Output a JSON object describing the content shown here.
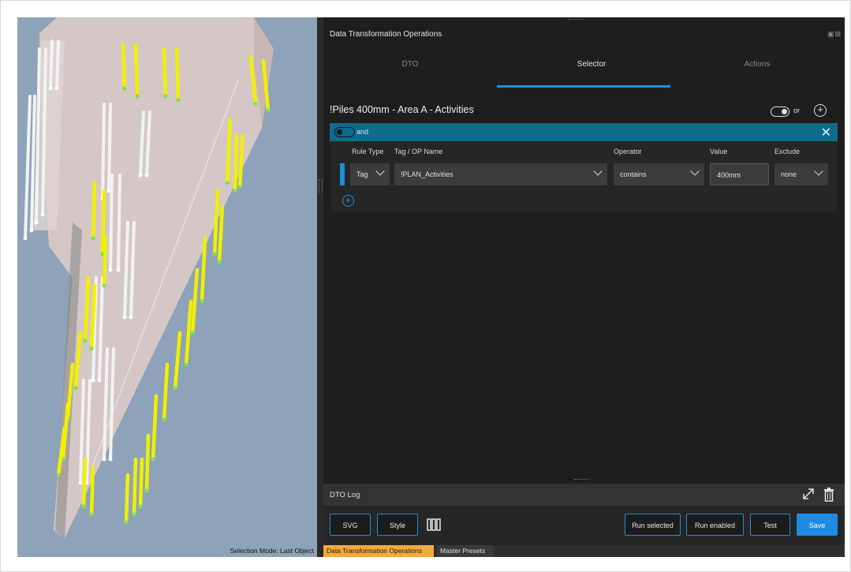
{
  "viewport": {
    "selection_mode": "Selection Mode: Last Object"
  },
  "panel": {
    "title": "Data Transformation Operations",
    "window_controls": "▣⊠",
    "tabs": [
      {
        "label": "DTO",
        "active": false
      },
      {
        "label": "Selector",
        "active": true
      },
      {
        "label": "Actions",
        "active": false
      }
    ],
    "preset_name": "!Piles 400mm - Area A - Activities",
    "group_logic": {
      "label": "or",
      "on": true
    }
  },
  "rule_group": {
    "logic_label": "and",
    "logic_on": false,
    "columns": {
      "rule_type": "Rule Type",
      "tag": "Tag / OP Name",
      "operator": "Operator",
      "value": "Value",
      "exclude": "Exclude"
    },
    "rules": [
      {
        "rule_type": "Tag",
        "tag": "!PLAN_Activities",
        "operator": "contains",
        "value": "400mm",
        "exclude": "none"
      }
    ]
  },
  "log": {
    "label": "DTO Log"
  },
  "toolbar": {
    "svg": "SVG",
    "style": "Style",
    "run_selected": "Run selected",
    "run_enabled": "Run enabled",
    "test": "Test",
    "save": "Save"
  },
  "bottom_tabs": [
    {
      "label": "Data Transformation Operations",
      "active": true
    },
    {
      "label": "Master Presets",
      "active": false
    }
  ],
  "icons": {
    "add_group": "plus-circle-icon",
    "close_group": "close-icon",
    "add_rule": "plus-circle-icon",
    "expand": "expand-diagonal-icon",
    "delete": "trash-icon",
    "columns": "columns-icon"
  },
  "colors": {
    "accent": "#1e90d6",
    "group_header": "#0e6b8e",
    "save_button": "#1e8ce6",
    "active_bottom_tab": "#f4a93c",
    "panel_bg": "#1e1e1e",
    "viewport_bg": "#8ea3b9",
    "highlighted_pile": "#f0f000"
  }
}
